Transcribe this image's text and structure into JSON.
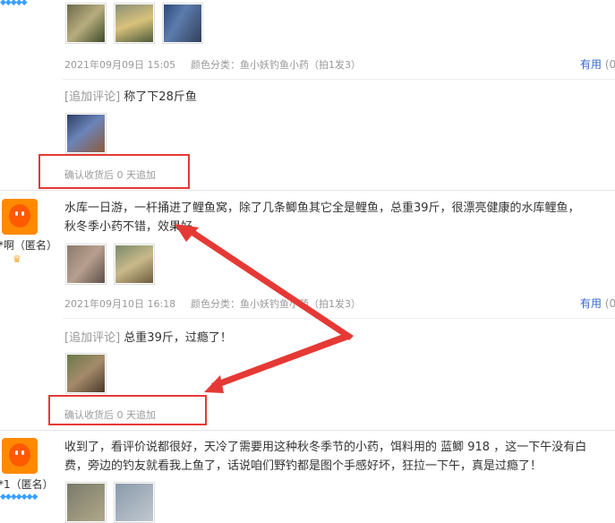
{
  "review1": {
    "date": "2021年09月09日 15:05",
    "spec": "颜色分类：鱼小妖钓鱼小药（拍1发3）",
    "useful": "有用",
    "useful_count": "(0",
    "append_label": "[追加评论]",
    "append_text": "称了下28斤鱼",
    "confirm": "确认收货后 0 天追加"
  },
  "review2": {
    "user": "*啊（匿名）",
    "text_line1": "水库一日游，一杆捅进了鲤鱼窝，除了几条鲫鱼其它全是鲤鱼，总重39斤，很漂亮健康的水库鲤鱼，",
    "text_line2": "秋冬季小药不错，效果好。",
    "date": "2021年09月10日 16:18",
    "spec": "颜色分类：鱼小妖钓鱼小药（拍1发3）",
    "useful": "有用",
    "useful_count": "(0",
    "append_label": "[追加评论]",
    "append_text": "总重39斤，过瘾了！",
    "confirm": "确认收货后 0 天追加"
  },
  "review3": {
    "user": "*1（匿名）",
    "text_line1": "收到了，看评价说都很好，天冷了需要用这种秋冬季节的小药，饵料用的 蓝鲫 918 ，这一下午没有白",
    "text_line2": "费，旁边的钓友就看我上鱼了，话说咱们野钓都是图个手感好坏，狂拉一下午，真是过瘾了！"
  },
  "colors": {
    "accent_red": "#e53935",
    "link_blue": "#3366cc",
    "avatar_orange": "#ff8a00"
  }
}
